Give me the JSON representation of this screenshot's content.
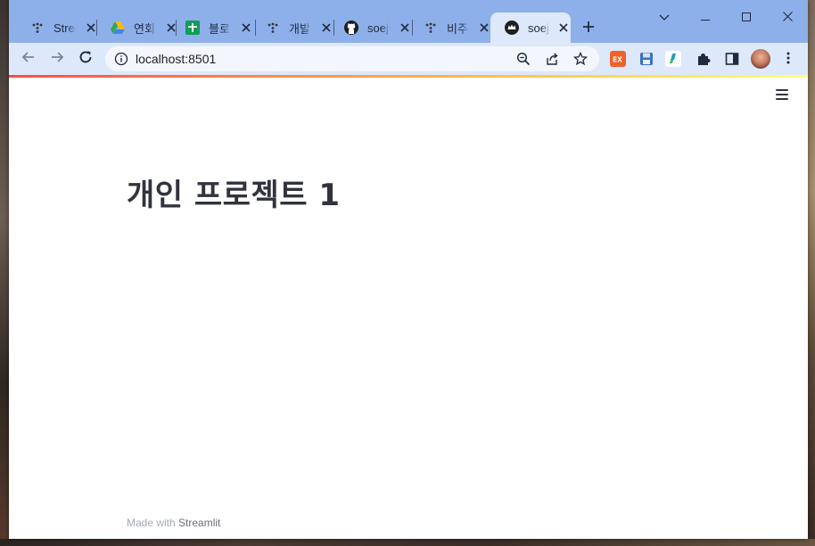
{
  "browser": {
    "tabs": [
      {
        "title": "Streamlit",
        "icon": "streamlit-icon"
      },
      {
        "title": "연회",
        "icon": "google-drive-icon"
      },
      {
        "title": "블로",
        "icon": "google-sheets-icon"
      },
      {
        "title": "개발",
        "icon": "streamlit-icon"
      },
      {
        "title": "soej",
        "icon": "github-icon"
      },
      {
        "title": "비주",
        "icon": "streamlit-icon"
      },
      {
        "title": "soej",
        "icon": "streamlit-crown-icon",
        "active": true
      }
    ],
    "new_tab_label": "+",
    "address": "localhost:8501",
    "extensions": [
      "ex-extension-icon",
      "save-extension-icon",
      "bookmark-extension-icon",
      "puzzle-icon",
      "side-panel-icon"
    ],
    "colors": {
      "tabstrip": "#8eb0ea",
      "toolbar": "#dde8fb",
      "omnibox": "#f3f6fc"
    }
  },
  "app": {
    "title": "개인 프로젝트 1",
    "footer_prefix": "Made with ",
    "footer_brand": "Streamlit",
    "colors": {
      "text": "#31333f",
      "accent_start": "#ff4b4b",
      "accent_end": "#fffd80"
    }
  }
}
